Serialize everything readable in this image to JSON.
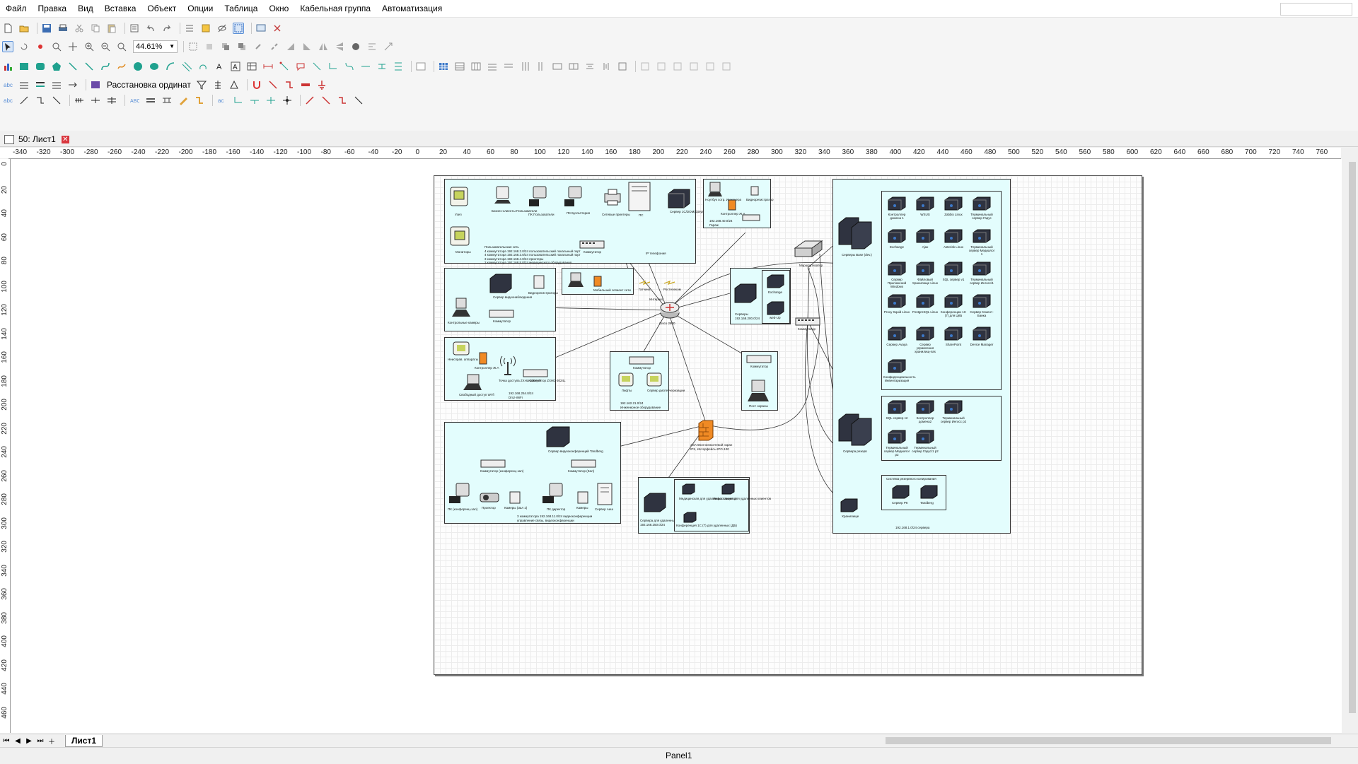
{
  "menu": [
    "Файл",
    "Правка",
    "Вид",
    "Вставка",
    "Объект",
    "Опции",
    "Таблица",
    "Окно",
    "Кабельная группа",
    "Автоматизация"
  ],
  "toolbar": {
    "zoom": "44.61%",
    "distribute_label": "Расстановка ординат"
  },
  "document_tab": {
    "label": "50: Лист1"
  },
  "sheet_tab": {
    "label": "Лист1"
  },
  "status": {
    "panel": "Panel1"
  },
  "ruler_h": [
    "-340",
    "-320",
    "-300",
    "-280",
    "-260",
    "-240",
    "-220",
    "-200",
    "-180",
    "-160",
    "-140",
    "-120",
    "-100",
    "-80",
    "-60",
    "-40",
    "-20",
    "0",
    "20",
    "40",
    "60",
    "80",
    "100",
    "120",
    "140",
    "160",
    "180",
    "200",
    "220",
    "240",
    "260",
    "280",
    "300",
    "320",
    "340",
    "360",
    "380",
    "400",
    "420",
    "440",
    "460",
    "480",
    "500",
    "520",
    "540",
    "560",
    "580",
    "600",
    "620",
    "640",
    "660",
    "680",
    "700",
    "720",
    "740",
    "760"
  ],
  "ruler_v": [
    "0",
    "20",
    "40",
    "60",
    "80",
    "100",
    "120",
    "140",
    "160",
    "180",
    "200",
    "220",
    "240",
    "260",
    "280",
    "300",
    "320",
    "340",
    "360",
    "380",
    "400",
    "420",
    "440",
    "460"
  ],
  "diagram": {
    "g1": {
      "devices": [
        "Узел",
        "Бизнес-клиенты Пользователи",
        "ПК Пользователи",
        "ПК Бухгалтерия",
        "Сетевые принтеры",
        "ПС",
        "Сервер 1С/DOM/Документооборот (архивный)",
        "Мониторы"
      ],
      "switch": "Коммутатор",
      "text": "Пользовательская сеть\n4 коммутатора 192.168.2.0/24 пользовательский локальный порт\n4 коммутатора 192.168.3.0/24 пользовательский локальный порт\n3 коммутатора 192.168.4.0/24 принтеры\n2 коммутатора 192.168.5.0/24 медицинского оборудования",
      "ip_phone": "IP телефония"
    },
    "g2": {
      "devices": [
        "Ноутбук сотр. Инженера",
        "Контроллер Ж.А",
        "Видеорегистратор"
      ],
      "text": "192.168.40.0/24\nГараж"
    },
    "g3": {
      "devices": [
        "Сервер видеонаблюдения",
        "Видеорегистраторы",
        "Контрольные камеры"
      ],
      "switch": "Коммутатор"
    },
    "g4": {
      "devices": [
        "Мобильный сегмент сети"
      ]
    },
    "wan": [
      "Гатчина",
      "Интернет",
      "Ростелеком"
    ],
    "g5": {
      "devices": [
        "Exchange",
        "web-Up"
      ],
      "text": "Серверы\n192.168.200.0/24"
    },
    "router": "Cisco 2800",
    "g6": {
      "devices": [
        "Неисправ. аппараты",
        "Контроллер Ж.А",
        "Точка доступа ZXHL-3004AP",
        "Свободный доступ Wi-fi"
      ],
      "switch": "Коммутатор ZXHD-3024L",
      "text": "192.168.254.0/24\nDmz-WiFi"
    },
    "g7": {
      "devices": [
        "Лифты",
        "Сервер диспетчеризации"
      ],
      "switch": "Коммутатор",
      "text": "192.162.21.0/24\nИнженерное оборудование"
    },
    "g8": {
      "devices": [
        "Пост охраны"
      ],
      "switch": "Коммутатор"
    },
    "g9": {
      "devices": [
        "Сервер видеоконференций Tandberg",
        "ПК (конференц-зал)",
        "Проектор",
        "Камеры (Зал 1)",
        "ПК директор",
        "Камеры",
        "Сервер Аиш"
      ],
      "switches": [
        "Коммутатор (конференц-зал)",
        "Коммутатор (Зал)"
      ],
      "text": "3 коммутатора 192.168.11.0/24 видеоконференции\nуправление связь, видеоконференции"
    },
    "firewall": "ASA 5510 межсетевой экран\nIPS, Интерфейсы IPO-100",
    "g10": {
      "devices": [
        "Сервера для удаленных клиентов",
        "Медицинская для удаленных клиентов",
        "Инфостанция для удаленных клиентов",
        "Конференция 1С (7) для удаленных (ДБ)"
      ],
      "text": "Сервера для удаленных клиентов\n192.168.250.0/24"
    },
    "core_switch": "Коммутатор",
    "wan_router": "Маршрутизатор",
    "servers_main": "Серверы Base (dev.)",
    "g11": {
      "devices": [
        "Контроллер домена 1",
        "WSUS",
        "Zabbix Linux",
        "Терминальный сервер Гарус",
        "Exchange",
        "Ajax",
        "Asterisk Linux",
        "Терминальный сервер Медиалог 1",
        "Сервер Приложений Windows",
        "Файловый Хранилище Linux",
        "SQL сервер v1",
        "Терминальный сервер Ингосс/1",
        "Proxy Squid Linux",
        "PostgreSQL Linux",
        "Конференции 1С (7) для ЦКБ",
        "Сервер Клиент-Банка",
        "Сервер Avaya",
        "Сервер управления хранилищ-nas",
        "SharePoint",
        "Device Manager",
        "Конфиденциальность Инвентаризация"
      ]
    },
    "servers_reserve": "Сервера резерв",
    "g12": {
      "devices": [
        "SQL сервер v2",
        "Контроллер домена2",
        "Терминальный сервер Ингосс р2",
        "Терминальный сервер Медиалог р2",
        "Терминальный сервер Гарус/1 р2"
      ]
    },
    "g13": {
      "title": "Система резервного копирования",
      "devices": [
        "Сервер РК",
        "Tandberg"
      ]
    },
    "storage": "Хранилище",
    "right_text": "192.168.1.0/24 сервера"
  }
}
